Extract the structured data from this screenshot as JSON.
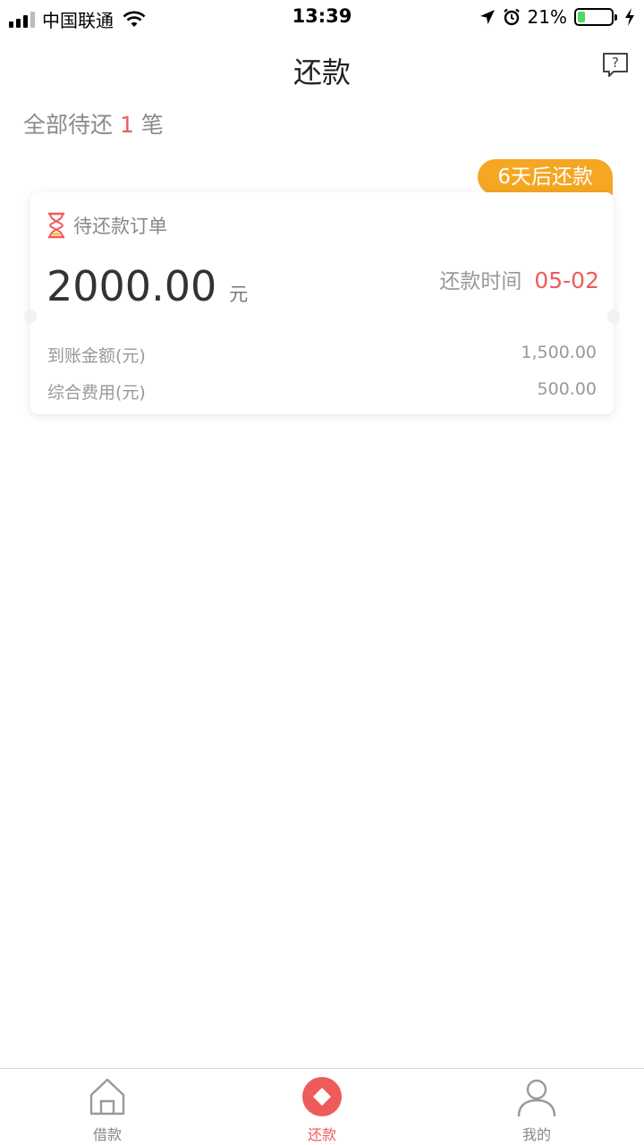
{
  "status_bar": {
    "carrier": "中国联通",
    "time": "13:39",
    "battery": "21%",
    "battery_level": 0.21
  },
  "nav": {
    "title": "还款",
    "help_icon": "question-bubble-icon"
  },
  "summary": {
    "prefix": "全部待还",
    "count": "1",
    "suffix": "笔"
  },
  "order": {
    "due_tag": "6天后还款",
    "title": "待还款订单",
    "amount": "2000.00",
    "amount_unit": "元",
    "repay_date_label": "还款时间",
    "repay_date": "05-02",
    "details": [
      {
        "label": "到账金额(元)",
        "value": "1,500.00"
      },
      {
        "label": "综合费用(元)",
        "value": "500.00"
      }
    ]
  },
  "tabs": [
    {
      "label": "借款",
      "icon": "home-icon"
    },
    {
      "label": "还款",
      "icon": "repay-icon"
    },
    {
      "label": "我的",
      "icon": "user-icon"
    }
  ],
  "colors": {
    "accent": "#ef5b5b",
    "tag": "#f5a623"
  }
}
